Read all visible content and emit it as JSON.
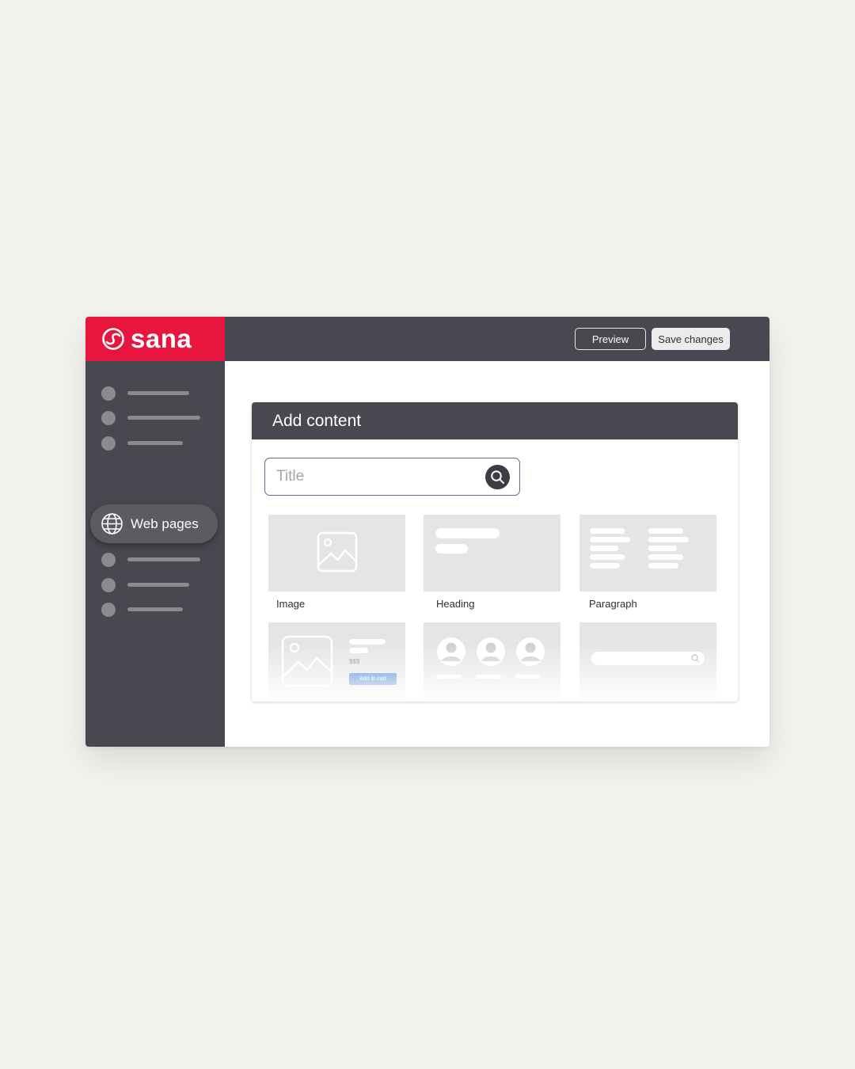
{
  "app": {
    "brand": "sana",
    "brand_color": "#e8163e"
  },
  "toolbar": {
    "preview_label": "Preview",
    "save_label": "Save changes"
  },
  "sidebar": {
    "active_item": {
      "label": "Web pages",
      "icon": "globe-icon"
    }
  },
  "panel": {
    "title": "Add content",
    "search_placeholder": "Title",
    "search_icon": "search-icon",
    "tiles": [
      {
        "label": "Image",
        "preview": "image-placeholder"
      },
      {
        "label": "Heading",
        "preview": "heading-placeholder"
      },
      {
        "label": "Paragraph",
        "preview": "paragraph-placeholder"
      },
      {
        "label": "",
        "preview": "product-card",
        "price": "$$$",
        "button": "Add to cart"
      },
      {
        "label": "",
        "preview": "people-avatars"
      },
      {
        "label": "",
        "preview": "search-bar"
      }
    ]
  },
  "colors": {
    "background": "#f3f2ef",
    "dark": "#484850",
    "accent_blue": "#3b7ed0"
  }
}
